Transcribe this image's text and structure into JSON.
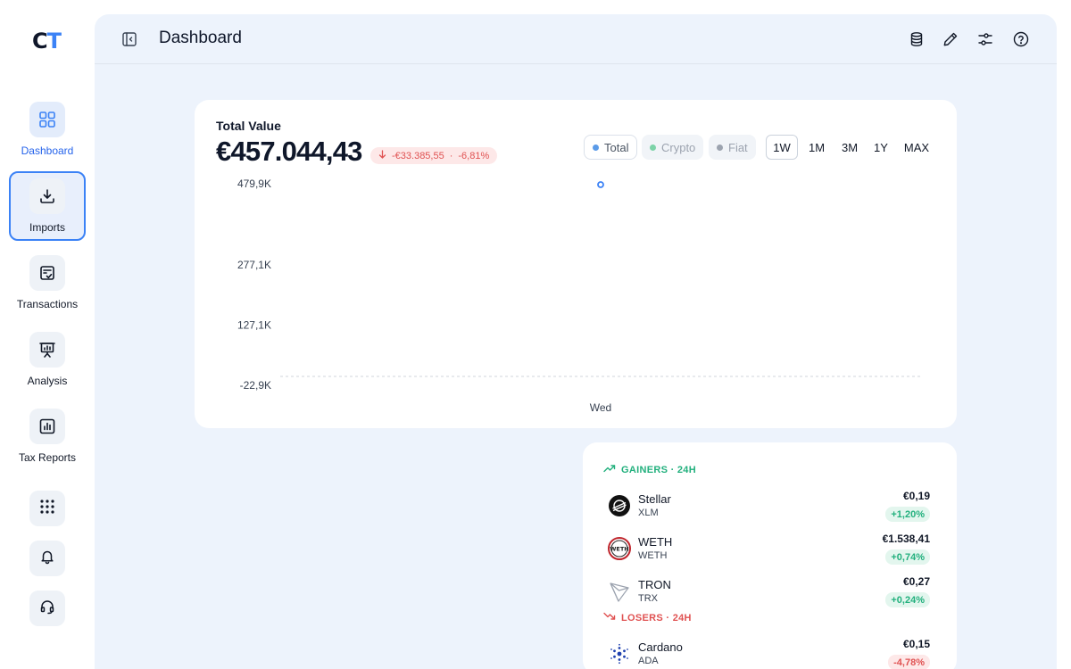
{
  "app": {
    "logo_c": "C",
    "logo_t": "T"
  },
  "sidebar": {
    "items": [
      {
        "label": "Dashboard"
      },
      {
        "label": "Imports"
      },
      {
        "label": "Transactions"
      },
      {
        "label": "Analysis"
      },
      {
        "label": "Tax Reports"
      }
    ]
  },
  "header": {
    "title": "Dashboard"
  },
  "total": {
    "label": "Total Value",
    "value": "€457.044,43",
    "change_abs": "-€33.385,55",
    "separator": "·",
    "change_pct": "-6,81%"
  },
  "legend": [
    {
      "label": "Total",
      "color": "#5b9be8"
    },
    {
      "label": "Crypto",
      "color": "#7dd3a8"
    },
    {
      "label": "Fiat",
      "color": "#9ca3af"
    }
  ],
  "ranges": [
    "1W",
    "1M",
    "3M",
    "1Y",
    "MAX"
  ],
  "chart_data": {
    "type": "line",
    "series": [
      {
        "values": [
          479.9
        ]
      }
    ],
    "categories": [
      "Wed"
    ],
    "y_ticks": [
      "479,9K",
      "277,1K",
      "127,1K",
      "-22,9K"
    ],
    "ylim": [
      -22.9,
      479.9
    ],
    "grid": false
  },
  "gainers": {
    "title": "GAINERS · 24H",
    "items": [
      {
        "name": "Stellar",
        "symbol": "XLM",
        "price": "€0,19",
        "change": "+1,20%"
      },
      {
        "name": "WETH",
        "symbol": "WETH",
        "price": "€1.538,41",
        "change": "+0,74%"
      },
      {
        "name": "TRON",
        "symbol": "TRX",
        "price": "€0,27",
        "change": "+0,24%"
      }
    ]
  },
  "losers": {
    "title": "LOSERS · 24H",
    "items": [
      {
        "name": "Cardano",
        "symbol": "ADA",
        "price": "€0,15",
        "change": "-4,78%"
      }
    ]
  }
}
